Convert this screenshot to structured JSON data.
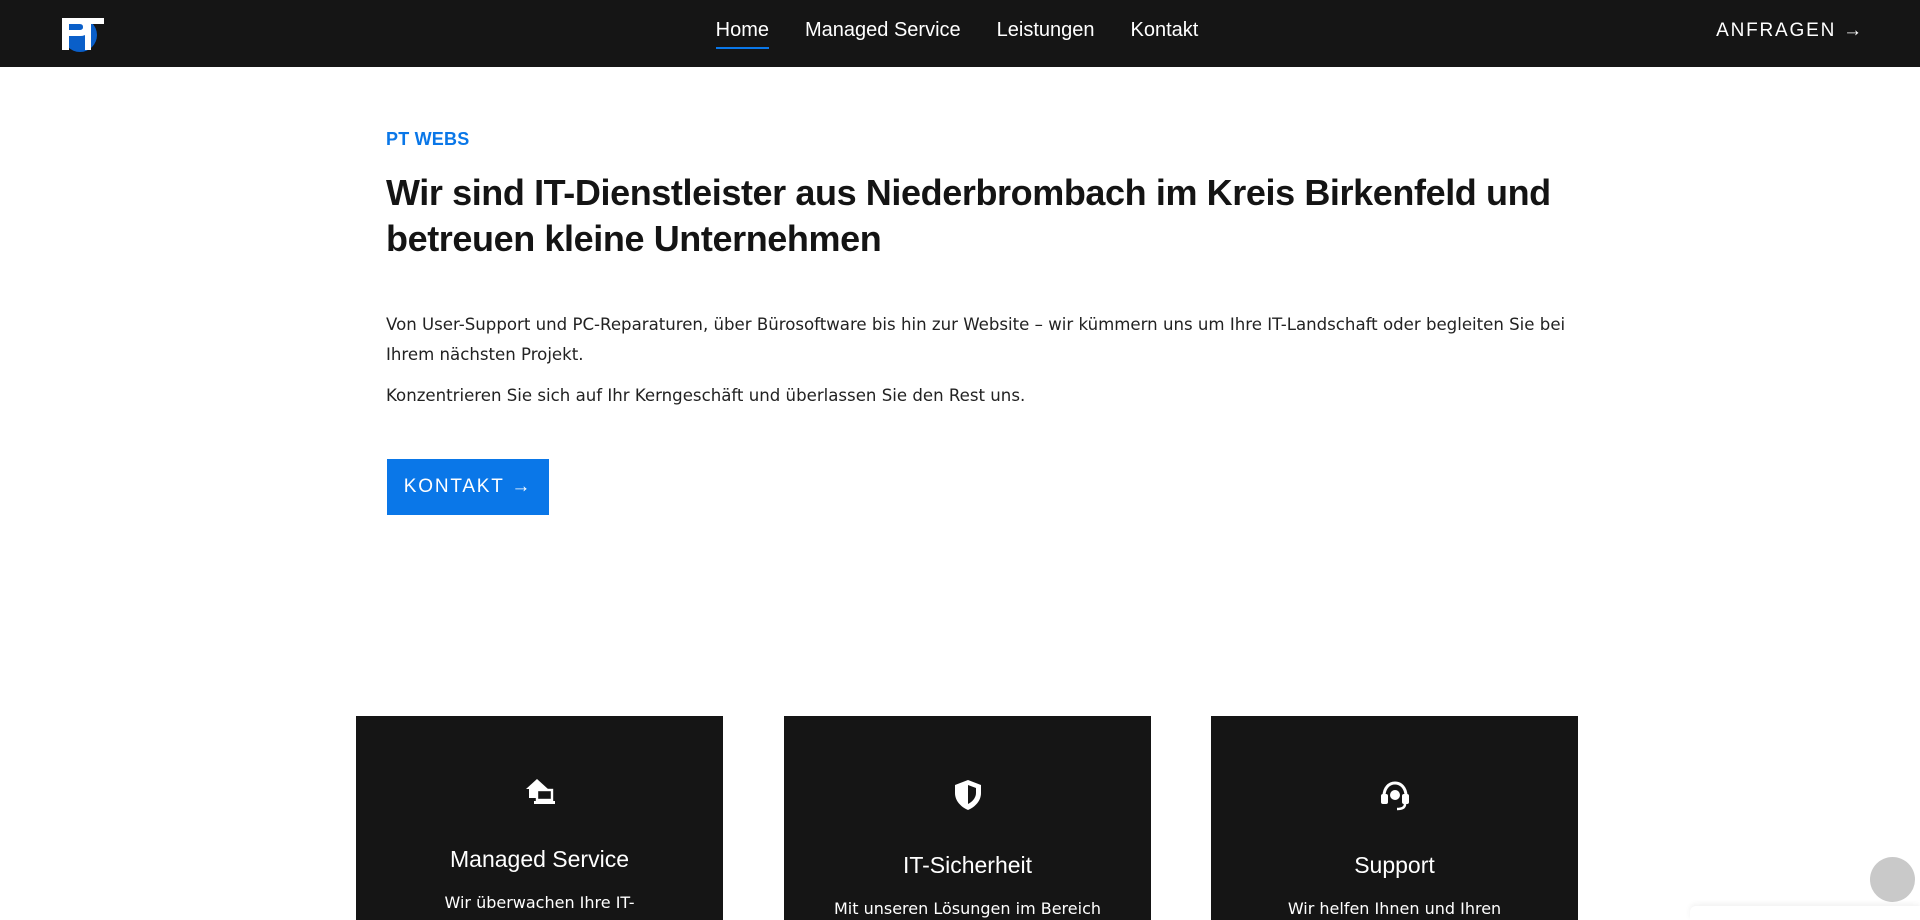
{
  "header": {
    "logo_text": "PT",
    "nav": [
      {
        "label": "Home",
        "active": true
      },
      {
        "label": "Managed Service",
        "active": false
      },
      {
        "label": "Leistungen",
        "active": false
      },
      {
        "label": "Kontakt",
        "active": false
      }
    ],
    "cta_label": "ANFRAGEN →"
  },
  "hero": {
    "eyebrow": "PT WEBS",
    "headline": "Wir sind IT-Dienstleister aus Niederbrombach im Kreis Birkenfeld und betreuen kleine Unternehmen",
    "paragraph1": "Von User-Support und PC-Reparaturen, über Bürosoftware bis hin zur Website – wir kümmern uns um Ihre IT-Landschaft oder begleiten Sie bei Ihrem nächsten Projekt.",
    "paragraph2": "Konzentrieren Sie sich auf Ihr Kerngeschäft und überlassen Sie den Rest uns.",
    "button_label": "KONTAKT →"
  },
  "cards": [
    {
      "icon": "home-laptop-icon",
      "title": "Managed Service",
      "text": "Wir überwachen Ihre IT-"
    },
    {
      "icon": "shield-icon",
      "title": "IT-Sicherheit",
      "text": "Mit unseren Lösungen im Bereich"
    },
    {
      "icon": "headset-icon",
      "title": "Support",
      "text": "Wir helfen Ihnen und Ihren"
    }
  ],
  "colors": {
    "accent": "#0a77e8",
    "dark": "#151515",
    "background": "#ffffff"
  }
}
